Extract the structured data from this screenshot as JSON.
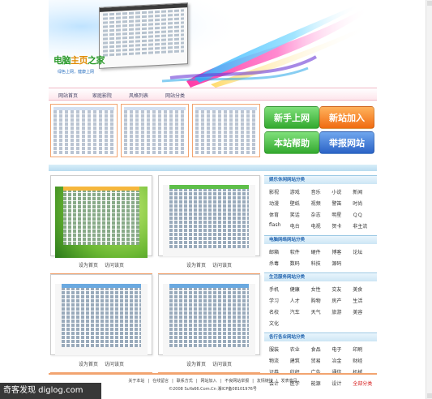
{
  "header": {
    "logo_part1": "电脑",
    "logo_part2": "主页",
    "logo_part3": "之家",
    "slogan": "绿色上网，健康上网"
  },
  "nav": {
    "items": [
      "网站首页",
      "家庭影院",
      "风格列表",
      "网站分类"
    ]
  },
  "buttons": {
    "new_site": "新手上网",
    "add_site": "新站加入",
    "help": "本站帮助",
    "report": "举报网站"
  },
  "cards": [
    {
      "set": "设为首页",
      "visit": "访问该页"
    },
    {
      "set": "设为首页",
      "visit": "访问该页"
    },
    {
      "set": "设为首页",
      "visit": "访问该页"
    },
    {
      "set": "设为首页",
      "visit": "访问该页"
    }
  ],
  "categories": [
    {
      "title": "娱乐休闲网站分类",
      "items": [
        "影视",
        "游戏",
        "音乐",
        "小说",
        "新闻",
        "动漫",
        "壁纸",
        "视频",
        "警笛",
        "时尚",
        "体育",
        "笑话",
        "杂志",
        "明星",
        "ＱＱ",
        "flash",
        "电台",
        "电视",
        "贺卡",
        "非主流"
      ]
    },
    {
      "title": "电脑网络网站分类",
      "items": [
        "邮箱",
        "软件",
        "硬件",
        "博客",
        "论坛",
        "杀毒",
        "数码",
        "科技",
        "源码"
      ]
    },
    {
      "title": "生活服务网站分类",
      "items": [
        "手机",
        "健康",
        "女性",
        "交友",
        "美食",
        "学习",
        "人才",
        "购物",
        "房产",
        "生活",
        "名校",
        "汽车",
        "天气",
        "旅游",
        "美容",
        "文化"
      ]
    },
    {
      "title": "各行各业网站分类",
      "items": [
        "服装",
        "农业",
        "食品",
        "电子",
        "印刷",
        "物流",
        "建筑",
        "贸易",
        "冶金",
        "财经",
        "证券",
        "纺织",
        "广告",
        "通信",
        "机械",
        "会计",
        "医学",
        "能源",
        "设计",
        "全部分类"
      ]
    }
  ],
  "footer": {
    "links": [
      "关于本站",
      "在线留言",
      "联系方式",
      "网站加入",
      "不良网站举报",
      "友情链接",
      "发表意见"
    ],
    "copyright": "©2008 SuYa66.Com.Cn  湘ICP备08101976号"
  },
  "watermark": "奇客发现  diglog.com"
}
